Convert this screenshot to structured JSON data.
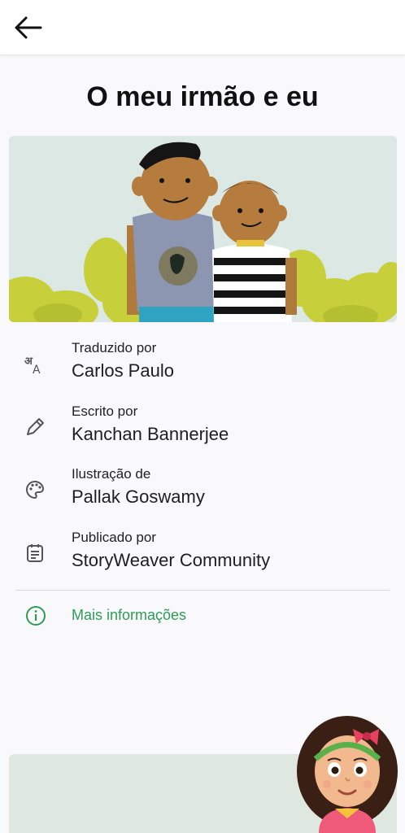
{
  "book": {
    "title": "O meu irmão e eu"
  },
  "credits": [
    {
      "label": "Traduzido por",
      "value": "Carlos Paulo",
      "icon": "translate-icon"
    },
    {
      "label": "Escrito por",
      "value": "Kanchan Bannerjee",
      "icon": "pencil-icon"
    },
    {
      "label": "Ilustração de",
      "value": "Pallak Goswamy",
      "icon": "palette-icon"
    },
    {
      "label": "Publicado por",
      "value": "StoryWeaver Community",
      "icon": "publisher-icon"
    }
  ],
  "more_info": {
    "label": "Mais informações",
    "icon": "info-icon"
  },
  "colors": {
    "accent_green": "#2e9c57",
    "icon_gray": "#555555"
  }
}
